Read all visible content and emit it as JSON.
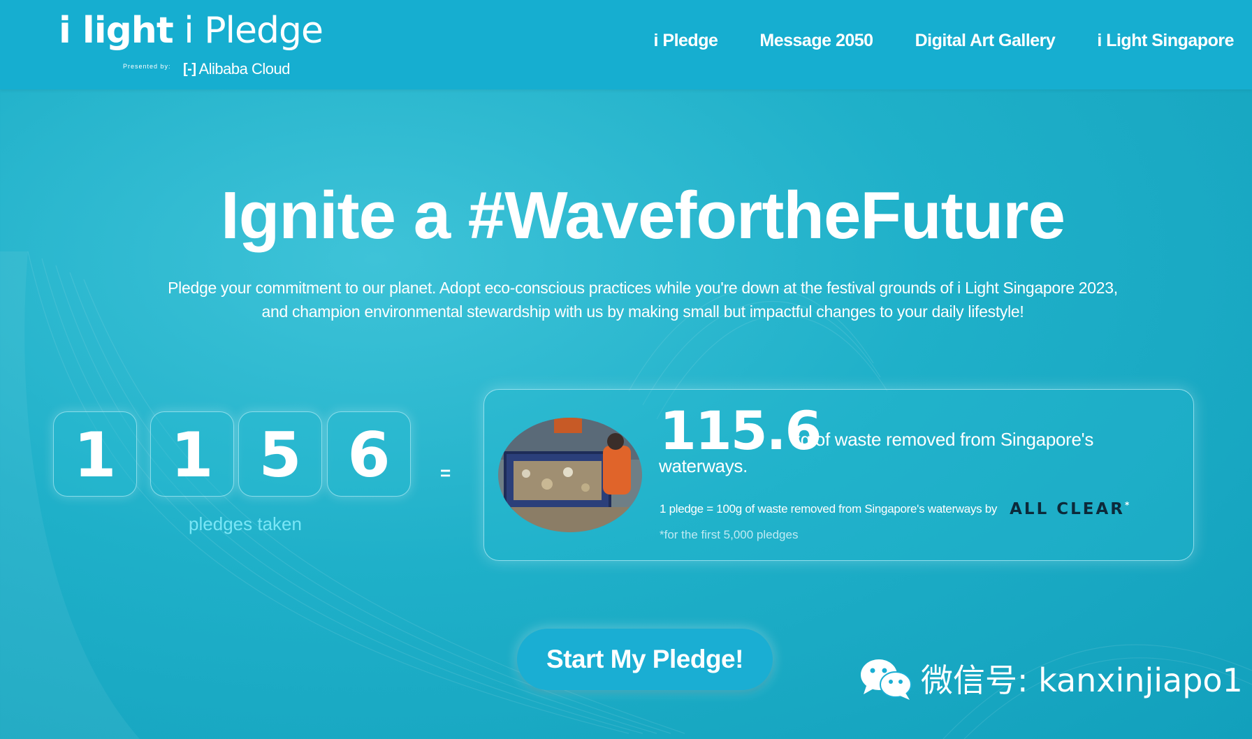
{
  "header": {
    "logo_title_part1": "i light",
    "logo_title_part2": " i Pledge",
    "presented_by": "Presented by:",
    "sponsor": "Alibaba Cloud",
    "sponsor_mark": "[-]"
  },
  "nav": {
    "items": [
      "i Pledge",
      "Message 2050",
      "Digital Art Gallery",
      "i Light Singapore"
    ]
  },
  "hero": {
    "title": "Ignite a #WavefortheFuture",
    "description": "Pledge your commitment to our planet. Adopt eco-conscious practices while you're down at the festival grounds of i Light Singapore 2023, and champion environmental stewardship with us by making small but impactful changes to your daily lifestyle!"
  },
  "counter": {
    "digits": [
      "1",
      "1",
      "5",
      "6"
    ],
    "label": "pledges taken",
    "equals": "="
  },
  "impact": {
    "kg_value": "115.6",
    "kg_text": "kg of waste removed from Singapore's waterways.",
    "rule": "1 pledge = 100g of waste removed from Singapore's waterways by",
    "partner_logo": "ALL CLEAR",
    "partner_star": "*",
    "footnote": "*for the first 5,000 pledges"
  },
  "cta": {
    "label": "Start My Pledge!"
  },
  "watermark": {
    "text": "微信号: kanxinjiapo1",
    "icon": "wechat-icon"
  },
  "colors": {
    "header": "#16aed0",
    "background": "#1fb0c9",
    "accent_light": "#7ae6f6",
    "button": "#1aaed3"
  }
}
